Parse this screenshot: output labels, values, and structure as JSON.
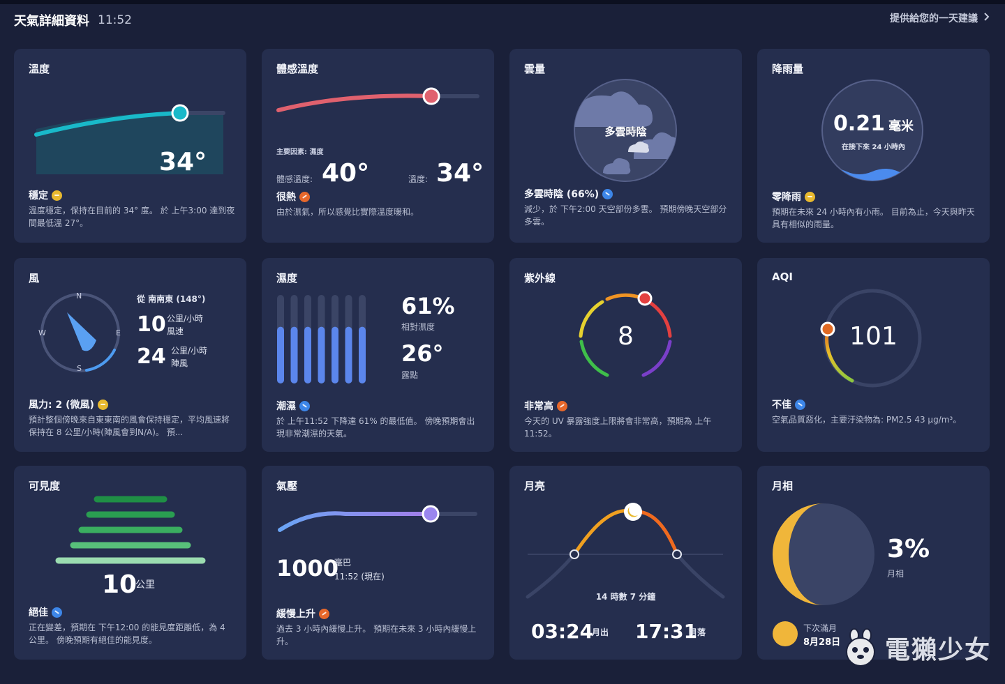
{
  "header": {
    "title": "天氣詳細資料",
    "time": "11:52",
    "link_label": "提供給您的一天建議"
  },
  "temperature": {
    "title": "溫度",
    "value": "34°",
    "status": "穩定",
    "description": "溫度穩定，保持在目前的 34° 度。 於 上午3:00 達到夜間最低溫 27°。",
    "level": 0.75
  },
  "feels_like": {
    "title": "體感溫度",
    "factor_label": "主要因素: 濕度",
    "feels_label": "體感溫度:",
    "feels_value": "40°",
    "temp_label": "溫度:",
    "temp_value": "34°",
    "status": "很熱",
    "description": "由於濕氣，所以感覺比實際溫度暖和。",
    "level": 0.76
  },
  "cloud": {
    "title": "雲量",
    "condition": "多雲時陰",
    "status": "多雲時陰 (66%)",
    "description": "減少，於 下午2:00 天空部份多雲。 預期傍晚天空部分多雲。",
    "percent": 66
  },
  "precipitation": {
    "title": "降雨量",
    "value": "0.21",
    "unit": "毫米",
    "period": "在接下來 24 小時內",
    "status": "零降雨",
    "description": "預期在未來 24 小時內有小雨。 目前為止，今天與昨天具有相似的雨量。"
  },
  "wind": {
    "title": "風",
    "direction": "從 南南東 (148°)",
    "direction_degrees": 148,
    "speed_value": "10",
    "speed_unit": "公里/小時",
    "speed_label": "風速",
    "gust_value": "24",
    "gust_unit": "公里/小時",
    "gust_label": "陣風",
    "compass": {
      "n": "N",
      "e": "E",
      "s": "S",
      "w": "W"
    },
    "status": "風力: 2 (微風)",
    "description": "預計整個傍晚來自東東南的風會保持穩定，平均風速將保持在 8 公里/小時(陣風會到N/A)。 預..."
  },
  "humidity": {
    "title": "濕度",
    "value": "61%",
    "value_label": "相對濕度",
    "dew_value": "26°",
    "dew_label": "露點",
    "status": "潮濕",
    "description": "於 上午11:52 下降達 61% 的最低值。 傍晚預期會出現非常潮濕的天氣。",
    "bars": [
      0.61,
      0.61,
      0.61,
      0.61,
      0.61,
      0.61,
      0.61
    ]
  },
  "uv": {
    "title": "紫外線",
    "value": "8",
    "status": "非常高",
    "description": "今天的 UV 暴露強度上限將會非常高，預期為 上午11:52。",
    "scale_max": 11
  },
  "aqi": {
    "title": "AQI",
    "value": "101",
    "status": "不佳",
    "description": "空氣品質惡化，主要汙染物為: PM2.5 43 µg/m³。",
    "scale_max": 300
  },
  "visibility": {
    "title": "可見度",
    "value": "10",
    "unit": "公里",
    "status": "絕佳",
    "description": "正在變差，預期在 下午12:00 的能見度距離低，為 4 公里。 傍晚預期有絕佳的能見度。"
  },
  "pressure": {
    "title": "氣壓",
    "value": "1000",
    "unit": "毫巴",
    "time_label": "11:52 (現在)",
    "status": "緩慢上升",
    "description": "過去 3 小時內緩慢上升。 預期在未來 3 小時內緩慢上升。",
    "level": 0.75
  },
  "moon": {
    "title": "月亮",
    "duration": "14 時數 7 分鐘",
    "rise_time": "03:24",
    "rise_label": "月出",
    "set_time": "17:31",
    "set_label": "月落"
  },
  "moon_phase": {
    "title": "月相",
    "value": "3%",
    "value_label": "月相",
    "next_full_label": "下次滿月",
    "next_full_date": "8月28日",
    "illumination": 0.03
  },
  "watermark": {
    "text": "電獺少女"
  },
  "colors": {
    "background": "#1a2039",
    "card": "#252e4e",
    "temp_line": "#19b9c9",
    "feels_line": "#e0616e",
    "pressure_line": "#9a86ee",
    "humidity_bar": "#5b86ec",
    "visibility_bar": "#2fa55a",
    "moon_arc": "#f0a020"
  }
}
